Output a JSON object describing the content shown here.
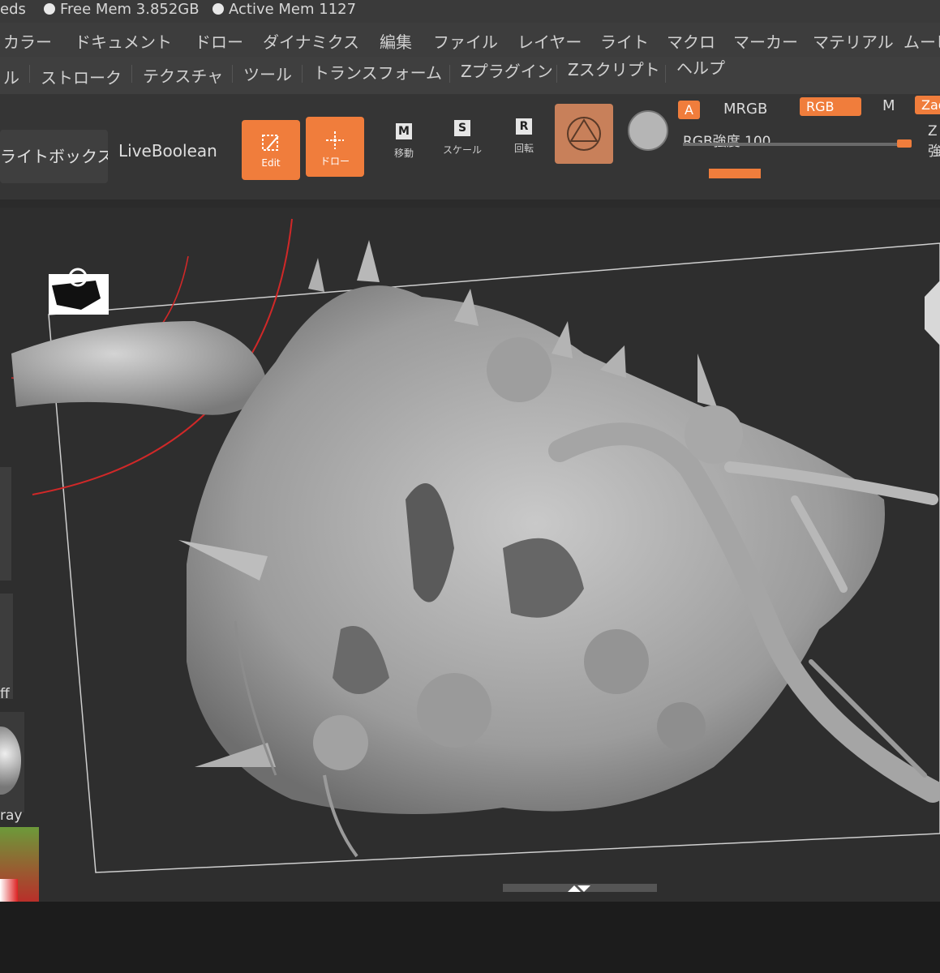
{
  "status": {
    "prefix": "eds",
    "free_mem": "Free Mem 3.852GB",
    "active_mem": "Active Mem 1127"
  },
  "menu_row1": [
    "カラー",
    "ドキュメント",
    "ドロー",
    "ダイナミクス",
    "編集",
    "ファイル",
    "レイヤー",
    "ライト",
    "マクロ",
    "マーカー",
    "マテリアル",
    "ムービ"
  ],
  "menu_row2": [
    "ル",
    "ストローク",
    "テクスチャ",
    "ツール",
    "トランスフォーム",
    "Zプラグイン",
    "Zスクリプト",
    "ヘルプ"
  ],
  "toolbar": {
    "lightbox": "ライトボックス",
    "liveboolean": "LiveBoolean",
    "edit_label": "Edit",
    "draw_label": "ドロー",
    "move_key": "M",
    "move_label": "移動",
    "scale_key": "S",
    "scale_label": "スケール",
    "rotate_key": "R",
    "rotate_label": "回転",
    "a_tag": "A",
    "mrgb_label": "MRGB",
    "rgb_tag": "RGB",
    "m_label": "M",
    "zadd_tag": "Zad",
    "rgb_intensity": "RGB強度 100",
    "z_label": "Z強"
  },
  "side_panel": {
    "off_label": "ff",
    "material_label": "ray"
  },
  "colors": {
    "accent": "#f07d3c",
    "background": "#2e2e2e",
    "menu": "#3d3d3d",
    "model": "#a9a9a9"
  },
  "icons": {
    "status_dot": "circle-icon",
    "edit": "edit-icon",
    "draw": "draw-icon",
    "material": "material-icon",
    "sphere": "sphere-icon",
    "navigation": "rotate-navigation-icon"
  }
}
